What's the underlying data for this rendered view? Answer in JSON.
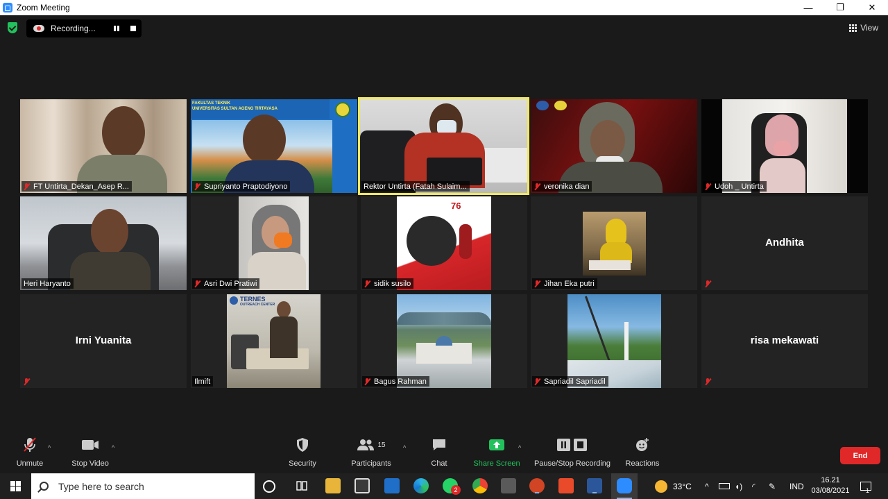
{
  "window": {
    "title": "Zoom Meeting",
    "minimize": "—",
    "maximize": "❐",
    "close": "✕"
  },
  "topbar": {
    "recording_label": "Recording...",
    "view_label": "View"
  },
  "participants": [
    {
      "name": "FT Untirta_Dekan_Asep R...",
      "muted": true
    },
    {
      "name": "Supriyanto Praptodiyono",
      "muted": true
    },
    {
      "name": "Rektor Untirta (Fatah Sulaim...",
      "muted": false,
      "active": true
    },
    {
      "name": "veronika dian",
      "muted": true
    },
    {
      "name": "Udoh _ Untirta",
      "muted": true
    },
    {
      "name": "Heri Haryanto",
      "muted": false
    },
    {
      "name": "Asri Dwi Pratiwi",
      "muted": true
    },
    {
      "name": "sidik susilo",
      "muted": true
    },
    {
      "name": "Jihan Eka putri",
      "muted": true
    },
    {
      "name": "Andhita",
      "muted": true,
      "video": false
    },
    {
      "name": "Irni Yuanita",
      "muted": true,
      "video": false
    },
    {
      "name": "Ilmift",
      "muted": false
    },
    {
      "name": "Bagus Rahman",
      "muted": true
    },
    {
      "name": "Sapriadil Sapriadil",
      "muted": true
    },
    {
      "name": "risa mekawati",
      "muted": true,
      "video": false
    }
  ],
  "tile_texts": {
    "ft_banner_1": "FAKULTAS TEKNIK",
    "ft_banner_2": "UNIVERSITAS SULTAN AGENG TIRTAYASA",
    "ternes": "TERNES",
    "ternes_sub": "OUTREACH CENTER",
    "poster_76": "76"
  },
  "toolbar": {
    "unmute": "Unmute",
    "stop_video": "Stop Video",
    "security": "Security",
    "participants": "Participants",
    "participants_count": "15",
    "chat": "Chat",
    "share_screen": "Share Screen",
    "pause_stop_recording": "Pause/Stop Recording",
    "reactions": "Reactions",
    "end": "End"
  },
  "taskbar": {
    "search_placeholder": "Type here to search",
    "weather": "33°C",
    "language": "IND",
    "time": "16.21",
    "date": "03/08/2021",
    "notification_count": "1",
    "whatsapp_badge": "2"
  },
  "colors": {
    "accent_blue": "#2d8cff",
    "end_red": "#e02828",
    "share_green": "#23c15d",
    "active_border": "#f2e85e"
  }
}
